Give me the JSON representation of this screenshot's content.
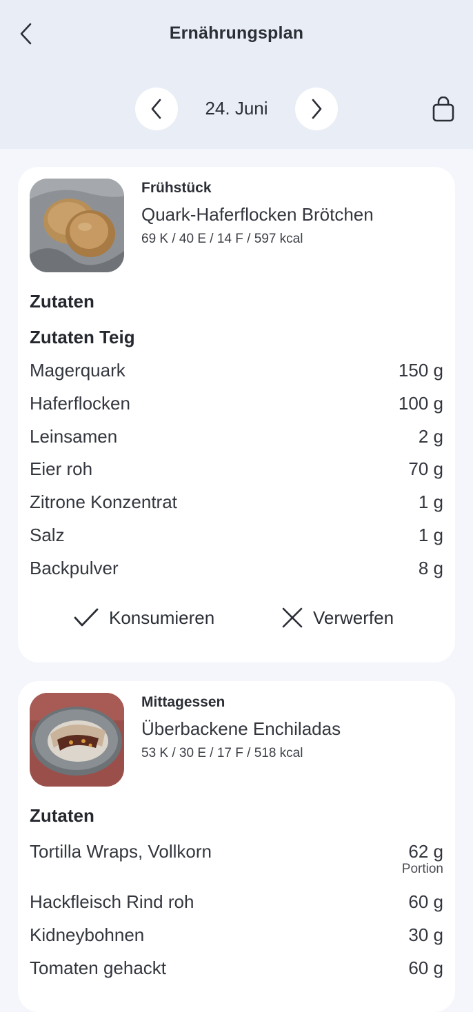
{
  "header": {
    "title": "Ernährungsplan",
    "date": "24. Juni"
  },
  "meals": [
    {
      "type": "Frühstück",
      "name": "Quark-Haferflocken Brötchen",
      "macros": "69 K / 40 E / 14 F / 597 kcal",
      "ingredients_title": "Zutaten",
      "group_title": "Zutaten Teig",
      "ingredients": [
        {
          "name": "Magerquark",
          "amount": "150 g"
        },
        {
          "name": "Haferflocken",
          "amount": "100 g"
        },
        {
          "name": "Leinsamen",
          "amount": "2 g"
        },
        {
          "name": "Eier roh",
          "amount": "70 g"
        },
        {
          "name": "Zitrone Konzentrat",
          "amount": "1 g"
        },
        {
          "name": "Salz",
          "amount": "1 g"
        },
        {
          "name": "Backpulver",
          "amount": "8 g"
        }
      ],
      "actions": {
        "consume": "Konsumieren",
        "discard": "Verwerfen"
      }
    },
    {
      "type": "Mittagessen",
      "name": "Überbackene Enchiladas",
      "macros": "53 K / 30 E / 17 F / 518 kcal",
      "ingredients_title": "Zutaten",
      "ingredients": [
        {
          "name": "Tortilla Wraps, Vollkorn",
          "amount": "62 g",
          "sub": "Portion"
        },
        {
          "name": "Hackfleisch Rind roh",
          "amount": "60 g"
        },
        {
          "name": "Kidneybohnen",
          "amount": "30 g"
        },
        {
          "name": "Tomaten gehackt",
          "amount": "60 g"
        }
      ]
    }
  ],
  "icons": {
    "back": "chevron-left-icon",
    "prev": "chevron-left-icon",
    "next": "chevron-right-icon",
    "shopping": "shopping-bag-icon",
    "consume": "checkmark-icon",
    "discard": "close-icon"
  }
}
